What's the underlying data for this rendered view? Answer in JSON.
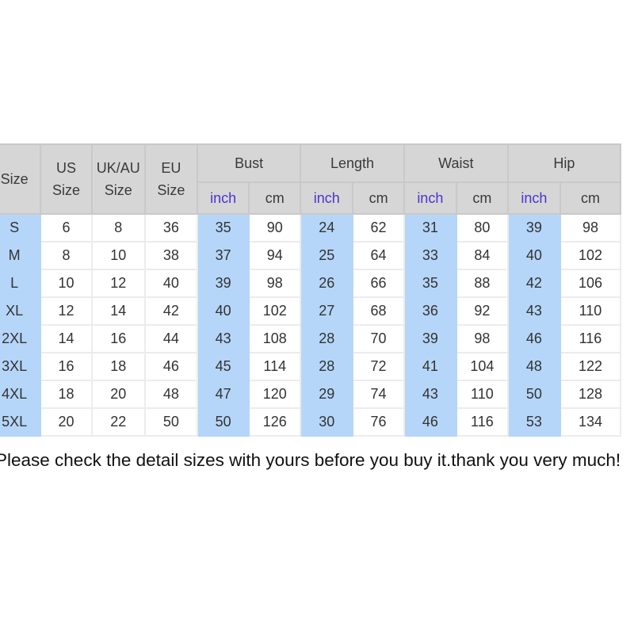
{
  "table": {
    "headers": {
      "size": "Size",
      "us": [
        "US",
        "Size"
      ],
      "uk": [
        "UK/AU",
        "Size"
      ],
      "eu": [
        "EU",
        "Size"
      ],
      "groups": [
        "Bust",
        "Length",
        "Waist",
        "Hip"
      ],
      "unit_inch": "inch",
      "unit_cm": "cm"
    },
    "rows": [
      [
        "S",
        "6",
        "8",
        "36",
        "35",
        "90",
        "24",
        "62",
        "31",
        "80",
        "39",
        "98"
      ],
      [
        "M",
        "8",
        "10",
        "38",
        "37",
        "94",
        "25",
        "64",
        "33",
        "84",
        "40",
        "102"
      ],
      [
        "L",
        "10",
        "12",
        "40",
        "39",
        "98",
        "26",
        "66",
        "35",
        "88",
        "42",
        "106"
      ],
      [
        "XL",
        "12",
        "14",
        "42",
        "40",
        "102",
        "27",
        "68",
        "36",
        "92",
        "43",
        "110"
      ],
      [
        "2XL",
        "14",
        "16",
        "44",
        "43",
        "108",
        "28",
        "70",
        "39",
        "98",
        "46",
        "116"
      ],
      [
        "3XL",
        "16",
        "18",
        "46",
        "45",
        "114",
        "28",
        "72",
        "41",
        "104",
        "48",
        "122"
      ],
      [
        "4XL",
        "18",
        "20",
        "48",
        "47",
        "120",
        "29",
        "74",
        "43",
        "110",
        "50",
        "128"
      ],
      [
        "5XL",
        "20",
        "22",
        "50",
        "50",
        "126",
        "30",
        "76",
        "46",
        "116",
        "53",
        "134"
      ]
    ]
  },
  "note": "Please check the detail sizes with yours before you buy it.thank you very much!",
  "colors": {
    "header_bg": "#d6d6d6",
    "inch_bg": "#b5d6f8",
    "inch_text": "#4a35d0"
  }
}
